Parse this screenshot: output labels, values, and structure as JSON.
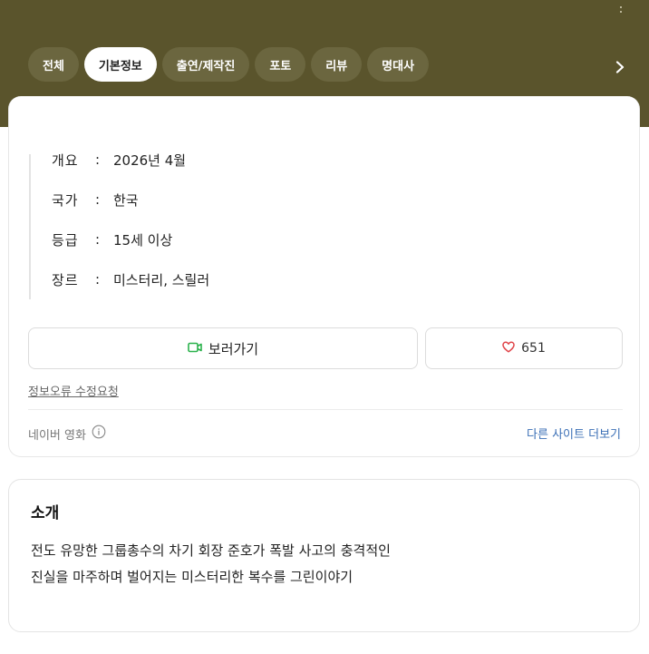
{
  "tabs": [
    {
      "label": "전체"
    },
    {
      "label": "기본정보"
    },
    {
      "label": "출연/제작진"
    },
    {
      "label": "포토"
    },
    {
      "label": "리뷰"
    },
    {
      "label": "명대사"
    }
  ],
  "active_tab_index": 1,
  "info": {
    "rows": [
      {
        "key": "개요",
        "sep": ":",
        "value": "2026년 4월"
      },
      {
        "key": "국가",
        "sep": ":",
        "value": "한국"
      },
      {
        "key": "등급",
        "sep": ":",
        "value": "15세 이상"
      },
      {
        "key": "장르",
        "sep": ":",
        "value": "미스터리, 스릴러"
      }
    ]
  },
  "actions": {
    "watch_label": "보러가기",
    "like_count": "651"
  },
  "report_link": "정보오류 수정요청",
  "source": {
    "label": "네이버 영화",
    "more_label": "다른 사이트 더보기"
  },
  "intro": {
    "title": "소개",
    "line1": "전도 유망한 그룹총수의 차기 회장 준호가 폭발 사고의 충격적인",
    "line2": "진실을 마주하며 벌어지는 미스터리한 복수를 그린이야기"
  },
  "colors": {
    "header_bg": "#5a542c",
    "tab_bg": "#6b663f",
    "accent_green": "#2bb24c",
    "heart_red": "#e0454a",
    "link_blue": "#3b6fb6"
  },
  "icons": {
    "more": "more-vertical-icon",
    "next": "chevron-right-icon",
    "watch": "video-camera-icon",
    "like": "heart-icon",
    "info": "info-circle-icon"
  }
}
